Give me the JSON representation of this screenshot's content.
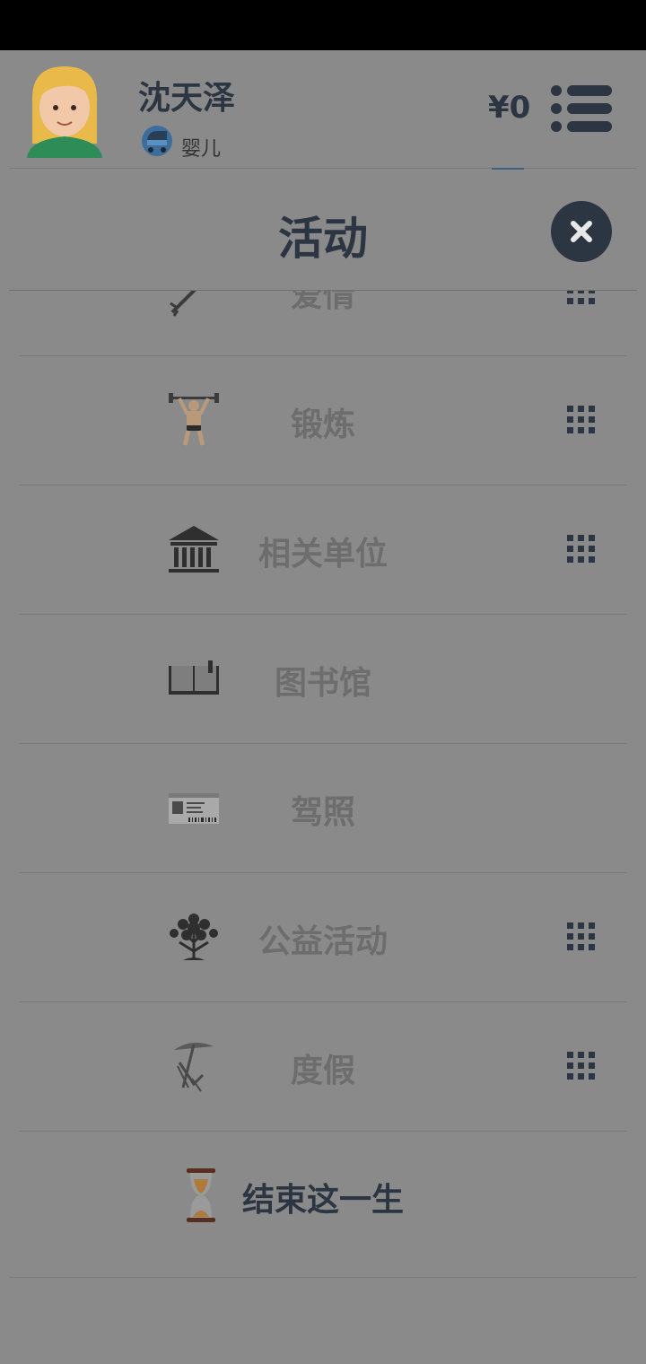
{
  "header": {
    "name": "沈天泽",
    "stage": "婴儿",
    "money": "¥0"
  },
  "dialog": {
    "title": "活动"
  },
  "activities": [
    {
      "label": "爱情",
      "icon": "cupid-arrow-icon",
      "has_grip": true
    },
    {
      "label": "锻炼",
      "icon": "weightlifter-icon",
      "has_grip": true
    },
    {
      "label": "相关单位",
      "icon": "government-building-icon",
      "has_grip": true
    },
    {
      "label": "图书馆",
      "icon": "open-book-icon",
      "has_grip": false
    },
    {
      "label": "驾照",
      "icon": "driver-license-icon",
      "has_grip": false
    },
    {
      "label": "公益活动",
      "icon": "tree-icon",
      "has_grip": true
    },
    {
      "label": "度假",
      "icon": "beach-chair-icon",
      "has_grip": true
    },
    {
      "label": "结束这一生",
      "icon": "hourglass-icon",
      "has_grip": false
    }
  ],
  "colors": {
    "overlay": "#8a8a8a",
    "dark": "#2c3542",
    "item_text": "#6d6d6d"
  }
}
